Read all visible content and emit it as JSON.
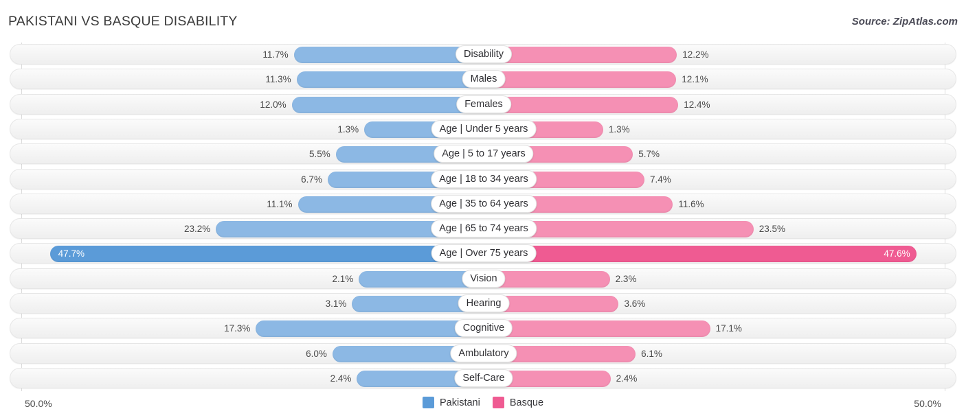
{
  "header": {
    "title": "PAKISTANI VS BASQUE DISABILITY",
    "source": "Source: ZipAtlas.com"
  },
  "axis": {
    "left_label": "50.0%",
    "right_label": "50.0%",
    "max": 50.0
  },
  "legend": [
    {
      "label": "Pakistani",
      "color": "#5b9bd8"
    },
    {
      "label": "Basque",
      "color": "#ef5b92"
    }
  ],
  "colors": {
    "left_bar": "#8cb8e4",
    "right_bar": "#f590b4",
    "left_bar_highlight": "#5b9bd8",
    "right_bar_highlight": "#ef5b92",
    "track": "#f4f4f4",
    "gridline": "#dcdcdc"
  },
  "chart_data": {
    "type": "bar",
    "title": "PAKISTANI VS BASQUE DISABILITY",
    "subtitle": "Source: ZipAtlas.com",
    "orientation": "horizontal-diverging",
    "xlabel": "",
    "ylabel": "",
    "xlim": [
      50.0,
      50.0
    ],
    "grid": true,
    "legend_position": "bottom-center",
    "categories": [
      "Disability",
      "Males",
      "Females",
      "Age | Under 5 years",
      "Age | 5 to 17 years",
      "Age | 18 to 34 years",
      "Age | 35 to 64 years",
      "Age | 65 to 74 years",
      "Age | Over 75 years",
      "Vision",
      "Hearing",
      "Cognitive",
      "Ambulatory",
      "Self-Care"
    ],
    "series": [
      {
        "name": "Pakistani",
        "color": "#8cb8e4",
        "values": [
          11.7,
          11.3,
          12.0,
          1.3,
          5.5,
          6.7,
          11.1,
          23.2,
          47.7,
          2.1,
          3.1,
          17.3,
          6.0,
          2.4
        ],
        "labels": [
          "11.7%",
          "11.3%",
          "12.0%",
          "1.3%",
          "5.5%",
          "6.7%",
          "11.1%",
          "23.2%",
          "47.7%",
          "2.1%",
          "3.1%",
          "17.3%",
          "6.0%",
          "2.4%"
        ]
      },
      {
        "name": "Basque",
        "color": "#f590b4",
        "values": [
          12.2,
          12.1,
          12.4,
          1.3,
          5.7,
          7.4,
          11.6,
          23.5,
          47.6,
          2.3,
          3.6,
          17.1,
          6.1,
          2.4
        ],
        "labels": [
          "12.2%",
          "12.1%",
          "12.4%",
          "1.3%",
          "5.7%",
          "7.4%",
          "11.6%",
          "23.5%",
          "47.6%",
          "2.3%",
          "3.6%",
          "17.1%",
          "6.1%",
          "2.4%"
        ]
      }
    ],
    "highlight_rows": [
      "Age | Over 75 years"
    ]
  },
  "rows": [
    {
      "label": "Disability",
      "left": "11.7%",
      "right": "12.2%",
      "lv": 11.7,
      "rv": 12.2
    },
    {
      "label": "Males",
      "left": "11.3%",
      "right": "12.1%",
      "lv": 11.3,
      "rv": 12.1
    },
    {
      "label": "Females",
      "left": "12.0%",
      "right": "12.4%",
      "lv": 12.0,
      "rv": 12.4
    },
    {
      "label": "Age | Under 5 years",
      "left": "1.3%",
      "right": "1.3%",
      "lv": 1.3,
      "rv": 1.3
    },
    {
      "label": "Age | 5 to 17 years",
      "left": "5.5%",
      "right": "5.7%",
      "lv": 5.5,
      "rv": 5.7
    },
    {
      "label": "Age | 18 to 34 years",
      "left": "6.7%",
      "right": "7.4%",
      "lv": 6.7,
      "rv": 7.4
    },
    {
      "label": "Age | 35 to 64 years",
      "left": "11.1%",
      "right": "11.6%",
      "lv": 11.1,
      "rv": 11.6
    },
    {
      "label": "Age | 65 to 74 years",
      "left": "23.2%",
      "right": "23.5%",
      "lv": 23.2,
      "rv": 23.5
    },
    {
      "label": "Age | Over 75 years",
      "left": "47.7%",
      "right": "47.6%",
      "lv": 47.7,
      "rv": 47.6,
      "highlight": true
    },
    {
      "label": "Vision",
      "left": "2.1%",
      "right": "2.3%",
      "lv": 2.1,
      "rv": 2.3
    },
    {
      "label": "Hearing",
      "left": "3.1%",
      "right": "3.6%",
      "lv": 3.1,
      "rv": 3.6
    },
    {
      "label": "Cognitive",
      "left": "17.3%",
      "right": "17.1%",
      "lv": 17.3,
      "rv": 17.1
    },
    {
      "label": "Ambulatory",
      "left": "6.0%",
      "right": "6.1%",
      "lv": 6.0,
      "rv": 6.1
    },
    {
      "label": "Self-Care",
      "left": "2.4%",
      "right": "2.4%",
      "lv": 2.4,
      "rv": 2.4
    }
  ]
}
